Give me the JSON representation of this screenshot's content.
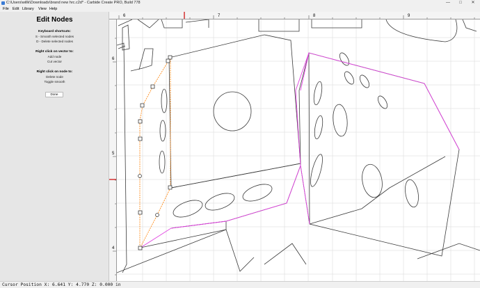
{
  "window": {
    "title": "C:\\Users\\willk\\Downloads\\brand new hrc.c2d* - Carbide Create PRO, Build 778",
    "minimize_glyph": "—",
    "maximize_glyph": "□",
    "close_glyph": "✕"
  },
  "menu": {
    "file": "File",
    "edit": "Edit",
    "library": "Library",
    "view": "View",
    "help": "Help"
  },
  "panel": {
    "title": "Edit Nodes",
    "shortcuts_header": "Keyboard shortcuts:",
    "shortcut_smooth": "S - Smooth selected nodes",
    "shortcut_delete": "D - Delete selected nodes",
    "vector_header": "Right click on vector to:",
    "vector_add": "Add node",
    "vector_cut": "Cut vector",
    "node_header": "Right click on node to:",
    "node_delete": "Delete node",
    "node_toggle": "Toggle smooth",
    "done_label": "Done"
  },
  "rulers": {
    "h_labels": [
      "6",
      "7",
      "8",
      "9"
    ],
    "v_labels": [
      "6",
      "5",
      "4"
    ]
  },
  "colors": {
    "grid": "#d6d6d6",
    "vector": "#3a3a3a",
    "selected_path": "#e040e0",
    "edit_path": "#ff8c1a",
    "ruler_marker": "#cc0000"
  },
  "status": {
    "cursor_text": "Cursor Position X: 6.641 Y: 4.770 Z: 0.000 in"
  }
}
